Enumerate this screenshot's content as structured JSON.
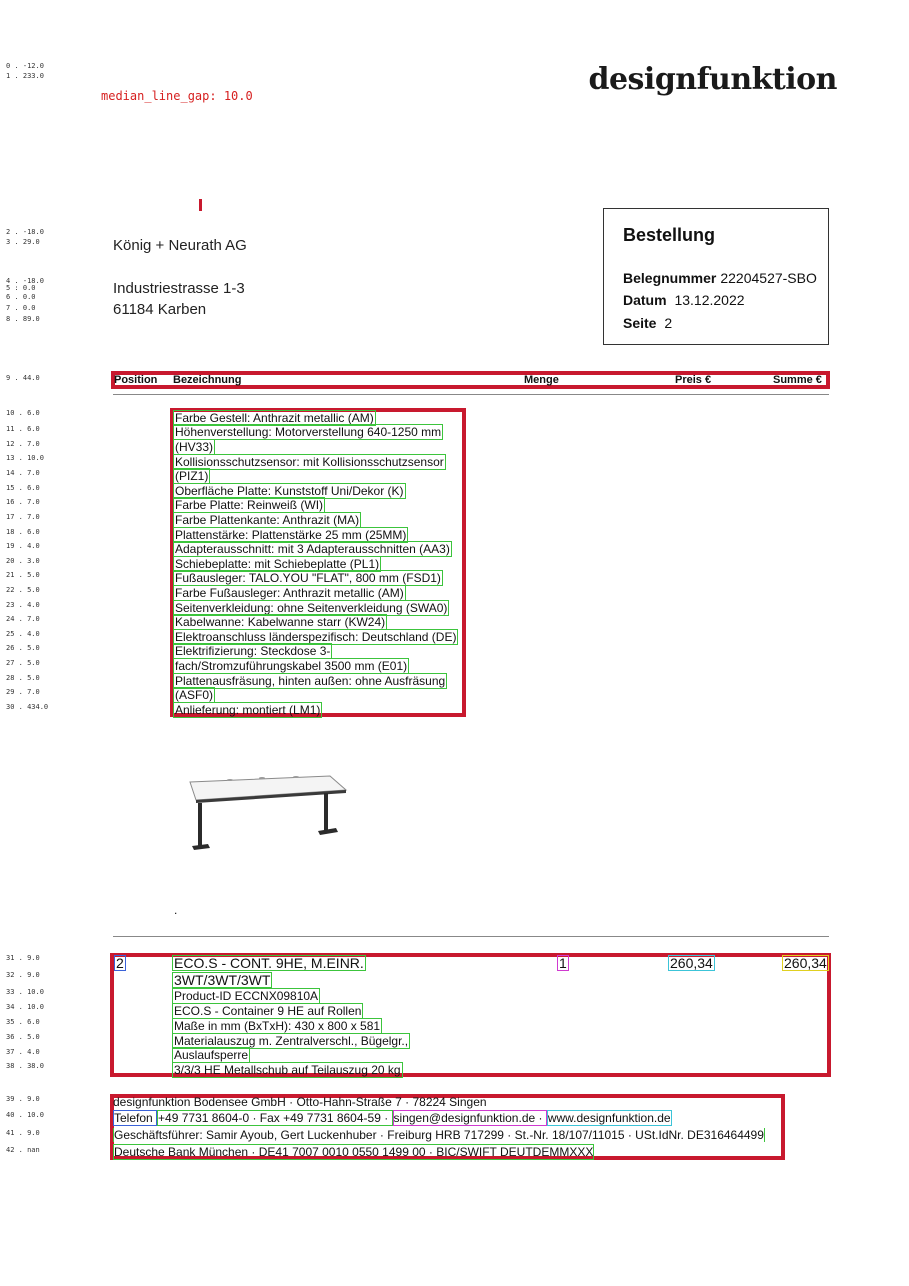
{
  "gutter_labels": [
    "0 . -12.0",
    "1 . 233.0",
    "2 . -18.0",
    "3 . 29.0",
    "4 . -18.0",
    "5 : 0.0",
    "6 . 0.0",
    "7 . 0.0",
    "8 . 89.0",
    "9 . 44.0",
    "10 . 6.0",
    "11 . 6.0",
    "12 . 7.0",
    "13 . 10.0",
    "14 . 7.0",
    "15 . 6.0",
    "16 . 7.0",
    "17 . 7.0",
    "18 . 6.0",
    "19 . 4.0",
    "20 . 3.0",
    "21 . 5.0",
    "22 . 5.0",
    "23 . 4.0",
    "24 . 7.0",
    "25 . 4.0",
    "26 . 5.0",
    "27 . 5.0",
    "28 . 5.0",
    "29 . 7.0",
    "30 . 434.0",
    "31 . 9.0",
    "32 . 9.0",
    "33 . 10.0",
    "34 . 10.0",
    "35 . 6.0",
    "36 . 5.0",
    "37 . 4.0",
    "38 . 38.0",
    "39 . 9.0",
    "40 . 10.0",
    "41 . 9.0",
    "42 . nan"
  ],
  "annotation": "median_line_gap: 10.0",
  "logo": "designfunktion",
  "recipient": {
    "company": "König + Neurath AG",
    "street": "Industriestrasse 1-3",
    "city": "61184 Karben"
  },
  "order": {
    "title": "Bestellung",
    "beleg_label": "Belegnummer",
    "beleg_value": "22204527-SBO",
    "datum_label": "Datum",
    "datum_value": "13.12.2022",
    "seite_label": "Seite",
    "seite_value": "2"
  },
  "table_header": {
    "position": "Position",
    "bezeichnung": "Bezeichnung",
    "menge": "Menge",
    "preis": "Preis €",
    "summe": "Summe €"
  },
  "spec_lines": [
    "Farbe Gestell: Anthrazit metallic (AM)",
    "Höhenverstellung: Motorverstellung 640-1250 mm",
    "(HV33)",
    "Kollisionsschutzsensor: mit Kollisionsschutzsensor",
    "(PIZ1)",
    "Oberfläche Platte: Kunststoff Uni/Dekor (K)",
    "Farbe Platte: Reinweiß (WI)",
    "Farbe Plattenkante: Anthrazit (MA)",
    "Plattenstärke: Plattenstärke 25 mm (25MM)",
    "Adapterausschnitt: mit 3 Adapterausschnitten (AA3)",
    "Schiebeplatte: mit Schiebeplatte (PL1)",
    "Fußausleger: TALO.YOU \"FLAT\", 800 mm (FSD1)",
    "Farbe Fußausleger: Anthrazit metallic (AM)",
    "Seitenverkleidung: ohne Seitenverkleidung (SWA0)",
    "Kabelwanne: Kabelwanne starr (KW24)",
    "Elektroanschluss länderspezifisch: Deutschland (DE)",
    "Elektrifizierung: Steckdose 3-",
    "fach/Stromzuführungskabel 3500 mm (E01)",
    "Plattenausfräsung, hinten außen: ohne Ausfräsung",
    "(ASF0)",
    "Anlieferung: montiert (LM1)"
  ],
  "dot": ".",
  "item2": {
    "position": "2",
    "title1": "ECO.S - CONT. 9HE, M.EINR.",
    "title2": "3WT/3WT/3WT",
    "menge": "1",
    "preis": "260,34",
    "summe": "260,34",
    "details": [
      "Product-ID ECCNX09810A",
      "ECO.S - Container 9 HE auf Rollen",
      "Maße in mm (BxTxH): 430 x 800 x 581",
      "Materialauszug m. Zentralverschl., Bügelgr.,",
      "Auslaufsperre",
      "3/3/3 HE Metallschub auf Teilauszug 20 kg"
    ]
  },
  "footer": {
    "line1": "designfunktion Bodensee GmbH · Otto-Hahn-Straße 7 · 78224 Singen",
    "tel_label": "Telefon ",
    "tel_rest": "+49 7731 8604-0 · Fax +49 7731 8604-59 · ",
    "email": "singen@designfunktion.de · ",
    "web": "www.designfunktion.de",
    "line3": "Geschäftsführer: Samir Ayoub, Gert Luckenhuber · Freiburg HRB 717299 · St.-Nr. 18/107/11015 · USt.IdNr. DE316464499",
    "line4": "Deutsche Bank München · DE41 7007 0010 0550 1499 00 · BIC/SWIFT DEUTDEMMXXX"
  },
  "colors": {
    "red_box": "#c8192e",
    "green_box": "#3cc43c",
    "annotation_red": "#d62020"
  }
}
